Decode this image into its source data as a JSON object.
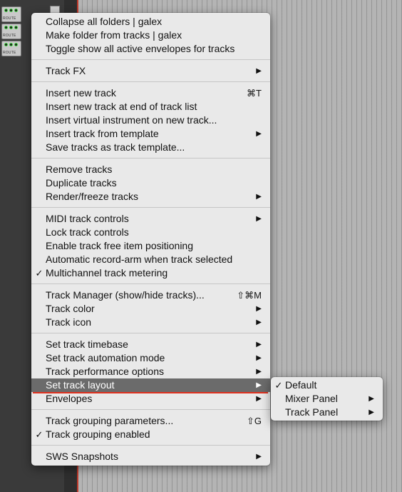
{
  "menu": {
    "groups": [
      [
        {
          "label": "Collapse all folders | galex"
        },
        {
          "label": "Make folder from tracks | galex"
        },
        {
          "label": "Toggle show all active envelopes for tracks"
        }
      ],
      [
        {
          "label": "Track FX",
          "submenu": true
        }
      ],
      [
        {
          "label": "Insert new track",
          "shortcut": "⌘T"
        },
        {
          "label": "Insert new track at end of track list"
        },
        {
          "label": "Insert virtual instrument on new track..."
        },
        {
          "label": "Insert track from template",
          "submenu": true
        },
        {
          "label": "Save tracks as track template..."
        }
      ],
      [
        {
          "label": "Remove tracks"
        },
        {
          "label": "Duplicate tracks"
        },
        {
          "label": "Render/freeze tracks",
          "submenu": true
        }
      ],
      [
        {
          "label": "MIDI track controls",
          "submenu": true
        },
        {
          "label": "Lock track controls"
        },
        {
          "label": "Enable track free item positioning"
        },
        {
          "label": "Automatic record-arm when track selected"
        },
        {
          "label": "Multichannel track metering",
          "checked": true
        }
      ],
      [
        {
          "label": "Track Manager (show/hide tracks)...",
          "shortcut": "⇧⌘M"
        },
        {
          "label": "Track color",
          "submenu": true
        },
        {
          "label": "Track icon",
          "submenu": true
        }
      ],
      [
        {
          "label": "Set track timebase",
          "submenu": true
        },
        {
          "label": "Set track automation mode",
          "submenu": true
        },
        {
          "label": "Track performance options",
          "submenu": true
        },
        {
          "label": "Set track layout",
          "submenu": true,
          "highlighted": true
        },
        {
          "label": "Envelopes",
          "submenu": true
        }
      ],
      [
        {
          "label": "Track grouping parameters...",
          "shortcut": "⇧G"
        },
        {
          "label": "Track grouping enabled",
          "checked": true
        }
      ],
      [
        {
          "label": "SWS Snapshots",
          "submenu": true
        }
      ]
    ]
  },
  "submenu": {
    "items": [
      {
        "label": "Default",
        "checked": true
      },
      {
        "label": "Mixer Panel",
        "submenu": true
      },
      {
        "label": "Track Panel",
        "submenu": true
      }
    ]
  },
  "tracks": [
    {
      "route_label": "ROUTE"
    },
    {
      "route_label": "ROUTE"
    },
    {
      "route_label": "ROUTE"
    }
  ],
  "glyphs": {
    "check": "✓",
    "arrow": "▶"
  },
  "colors": {
    "highlight": "#6b6b6b",
    "underline": "#e0301e"
  }
}
